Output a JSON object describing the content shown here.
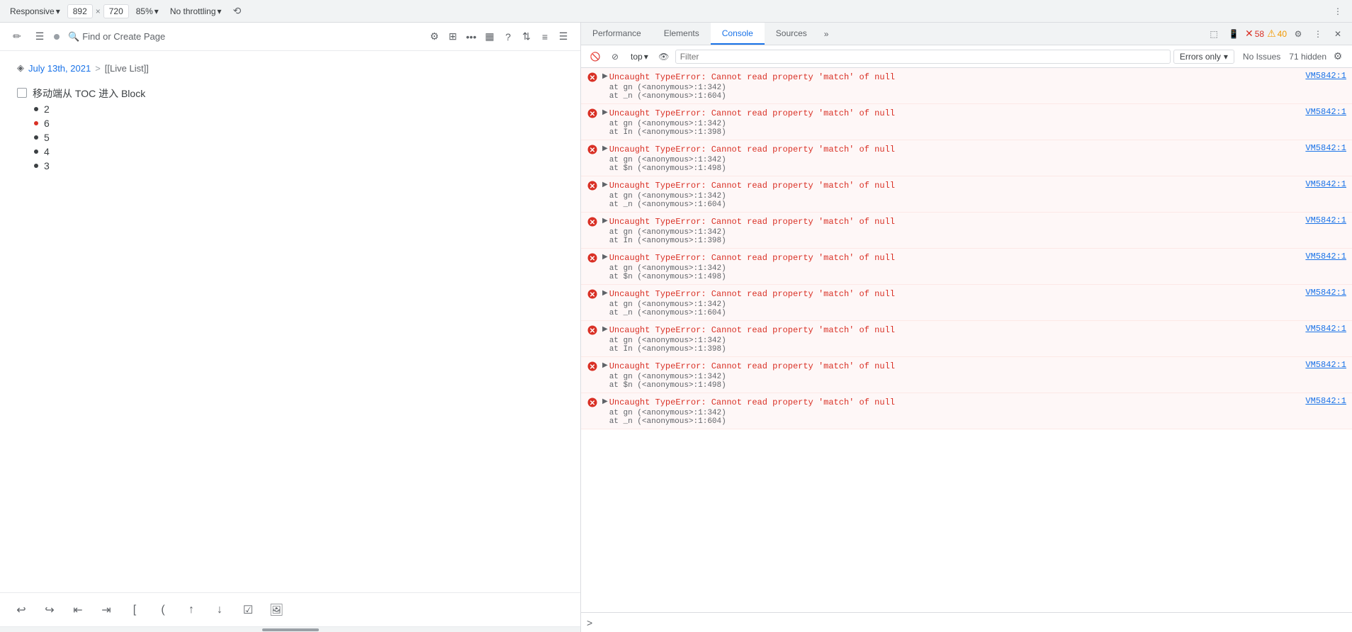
{
  "topbar": {
    "responsive_label": "Responsive",
    "width": "892",
    "height": "720",
    "zoom": "85%",
    "throttle": "No throttling",
    "more_icon": "⋮"
  },
  "editor": {
    "toolbar": {
      "pencil_icon": "✏",
      "list_icon": "☰",
      "dot_color": "#9aa0a6",
      "search_label": "Find or Create Page",
      "filter_icon": "⚙",
      "grid_icon": "⊞",
      "more_icon": "•••",
      "columns_icon": "▦",
      "help_icon": "?",
      "sort_icon": "⇅",
      "text_icon": "≡",
      "menu_icon": "☰"
    },
    "breadcrumb": {
      "parent": "July 13th, 2021",
      "separator": ">",
      "child": "[[Live List]]"
    },
    "blocks": [
      {
        "type": "checkbox",
        "text": "移动端从 TOC 进入 Block",
        "checked": false
      }
    ],
    "list_items": [
      {
        "num": "2",
        "bullet": false,
        "color": "default"
      },
      {
        "num": "6",
        "bullet": true,
        "color": "red"
      },
      {
        "num": "5",
        "bullet": false,
        "color": "default"
      },
      {
        "num": "4",
        "bullet": false,
        "color": "default"
      },
      {
        "num": "3",
        "bullet": false,
        "color": "default"
      }
    ],
    "bottom_toolbar": {
      "undo": "↩",
      "redo": "↪",
      "outdent": "⇤",
      "indent": "⇥",
      "bracket_open": "[",
      "paren_open": "(",
      "arrow_up": "↑",
      "arrow_down": "↓",
      "checkbox": "☑",
      "image": "🖼"
    }
  },
  "devtools": {
    "tabs": [
      {
        "label": "Performance",
        "active": false
      },
      {
        "label": "Elements",
        "active": false
      },
      {
        "label": "Console",
        "active": true
      },
      {
        "label": "Sources",
        "active": false
      }
    ],
    "tab_more": "»",
    "icons": {
      "inspect": "⬚",
      "device": "📱",
      "error_count": "58",
      "warn_count": "40",
      "settings": "⚙",
      "more": "⋮",
      "close": "✕"
    },
    "console_toolbar": {
      "clear_icon": "🚫",
      "filter_icon": "⊘",
      "context_label": "top",
      "context_arrow": "▾",
      "eye_icon": "👁",
      "filter_placeholder": "Filter",
      "errors_only_label": "Errors only",
      "errors_only_arrow": "▾",
      "no_issues_label": "No Issues",
      "hidden_count": "71 hidden",
      "settings_icon": "⚙"
    },
    "errors": [
      {
        "id": 1,
        "main_text": "Uncaught TypeError: Cannot read property 'match' of null",
        "traces": [
          "at gn (<anonymous>:1:342)",
          "at _n (<anonymous>:1:604)"
        ],
        "source": "VM5842:1"
      },
      {
        "id": 2,
        "main_text": "Uncaught TypeError: Cannot read property 'match' of null",
        "traces": [
          "at gn (<anonymous>:1:342)",
          "at In (<anonymous>:1:398)"
        ],
        "source": "VM5842:1"
      },
      {
        "id": 3,
        "main_text": "Uncaught TypeError: Cannot read property 'match' of null",
        "traces": [
          "at gn (<anonymous>:1:342)",
          "at $n (<anonymous>:1:498)"
        ],
        "source": "VM5842:1"
      },
      {
        "id": 4,
        "main_text": "Uncaught TypeError: Cannot read property 'match' of null",
        "traces": [
          "at gn (<anonymous>:1:342)",
          "at _n (<anonymous>:1:604)"
        ],
        "source": "VM5842:1"
      },
      {
        "id": 5,
        "main_text": "Uncaught TypeError: Cannot read property 'match' of null",
        "traces": [
          "at gn (<anonymous>:1:342)",
          "at In (<anonymous>:1:398)"
        ],
        "source": "VM5842:1"
      },
      {
        "id": 6,
        "main_text": "Uncaught TypeError: Cannot read property 'match' of null",
        "traces": [
          "at gn (<anonymous>:1:342)",
          "at $n (<anonymous>:1:498)"
        ],
        "source": "VM5842:1"
      },
      {
        "id": 7,
        "main_text": "Uncaught TypeError: Cannot read property 'match' of null",
        "traces": [
          "at gn (<anonymous>:1:342)",
          "at _n (<anonymous>:1:604)"
        ],
        "source": "VM5842:1"
      },
      {
        "id": 8,
        "main_text": "Uncaught TypeError: Cannot read property 'match' of null",
        "traces": [
          "at gn (<anonymous>:1:342)",
          "at In (<anonymous>:1:398)"
        ],
        "source": "VM5842:1"
      },
      {
        "id": 9,
        "main_text": "Uncaught TypeError: Cannot read property 'match' of null",
        "traces": [
          "at gn (<anonymous>:1:342)",
          "at $n (<anonymous>:1:498)"
        ],
        "source": "VM5842:1"
      },
      {
        "id": 10,
        "main_text": "Uncaught TypeError: Cannot read property 'match' of null",
        "traces": [
          "at gn (<anonymous>:1:342)",
          "at _n (<anonymous>:1:604)"
        ],
        "source": "VM5842:1"
      }
    ],
    "console_prompt": ">"
  }
}
